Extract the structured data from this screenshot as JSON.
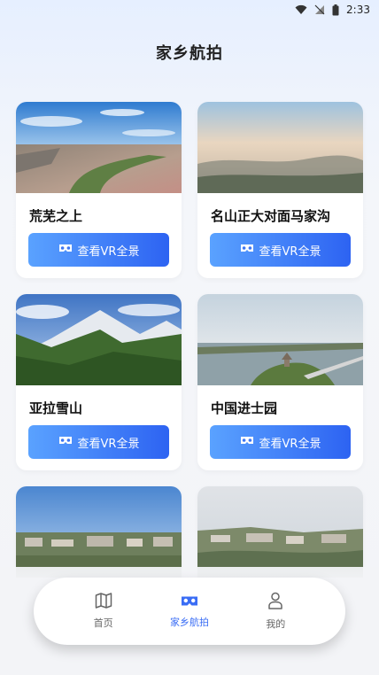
{
  "status_bar": {
    "time": "2:33"
  },
  "header": {
    "title": "家乡航拍"
  },
  "cards": [
    {
      "name": "荒芜之上",
      "button_label": "查看VR全景",
      "scene": "desert"
    },
    {
      "name": "名山正大对面马家沟",
      "button_label": "查看VR全景",
      "scene": "haze"
    },
    {
      "name": "亚拉雪山",
      "button_label": "查看VR全景",
      "scene": "snow"
    },
    {
      "name": "中国进士园",
      "button_label": "查看VR全景",
      "scene": "river"
    },
    {
      "scene": "town1"
    },
    {
      "scene": "town2"
    }
  ],
  "tabbar": {
    "items": [
      {
        "label": "首页",
        "icon": "map-icon",
        "active": false
      },
      {
        "label": "家乡航拍",
        "icon": "vr-icon",
        "active": true
      },
      {
        "label": "我的",
        "icon": "person-icon",
        "active": false
      }
    ]
  },
  "colors": {
    "accent": "#3a6df5",
    "button_start": "#5aa2ff",
    "button_end": "#2d63f2"
  }
}
